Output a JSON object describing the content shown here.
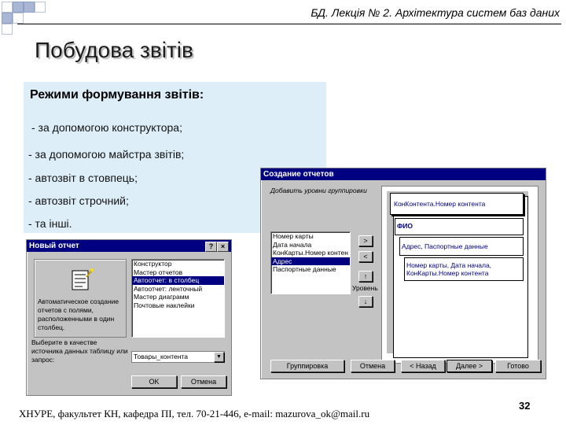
{
  "header": {
    "course": "БД. Лекція № 2. Архітектура систем баз даних",
    "title": "Побудова звітів"
  },
  "panel": {
    "heading": "Режими формування звітів:",
    "items": [
      " - за допомогою конструктора;",
      "-  за допомогою майстра звітів;",
      "-  автозвіт в стовпець;",
      "-  автозвіт строчний;",
      "- та інші."
    ]
  },
  "wizard": {
    "title": "Создание отчетов",
    "prompt": "Добавить уровни группировки",
    "fields": [
      "Номер карты",
      "Дата начала",
      "КонКарты.Номер контен",
      "Адрес",
      "Паспортные данные"
    ],
    "selected_field_index": 3,
    "arrow_buttons": [
      ">",
      "<",
      "↑"
    ],
    "priority_label": "Уровень",
    "preview": {
      "top": "КонКонтента.Номер контента",
      "fio": "ФИО",
      "line1": "Адрес, Паспортные данные",
      "line2": "Номер карты, Дата начала, КонКарты.Номер контента"
    },
    "buttons": [
      "Группировка",
      "Отмена",
      "< Назад",
      "Далее >",
      "Готово"
    ]
  },
  "new_report": {
    "title": "Новый отчет",
    "title_buttons": [
      "?",
      "×"
    ],
    "options": [
      "Конструктор",
      "Мастер отчетов",
      "Автоотчет: в столбец",
      "Автоотчет: ленточный",
      "Мастер диаграмм",
      "Почтовые наклейки"
    ],
    "selected_index": 2,
    "description": "Автоматическое создание отчетов с полями, расположенными в один столбец.",
    "source_prompt": "Выберите в качестве источника данных таблицу или запрос:",
    "source_value": "Товары_контента",
    "ok_label": "OK",
    "cancel_label": "Отмена"
  },
  "footer": "ХНУРЕ, факультет КН, кафедра ПІ, тел. 70-21-446, e-mail: mazurova_ok@mail.ru",
  "page_number": "32"
}
